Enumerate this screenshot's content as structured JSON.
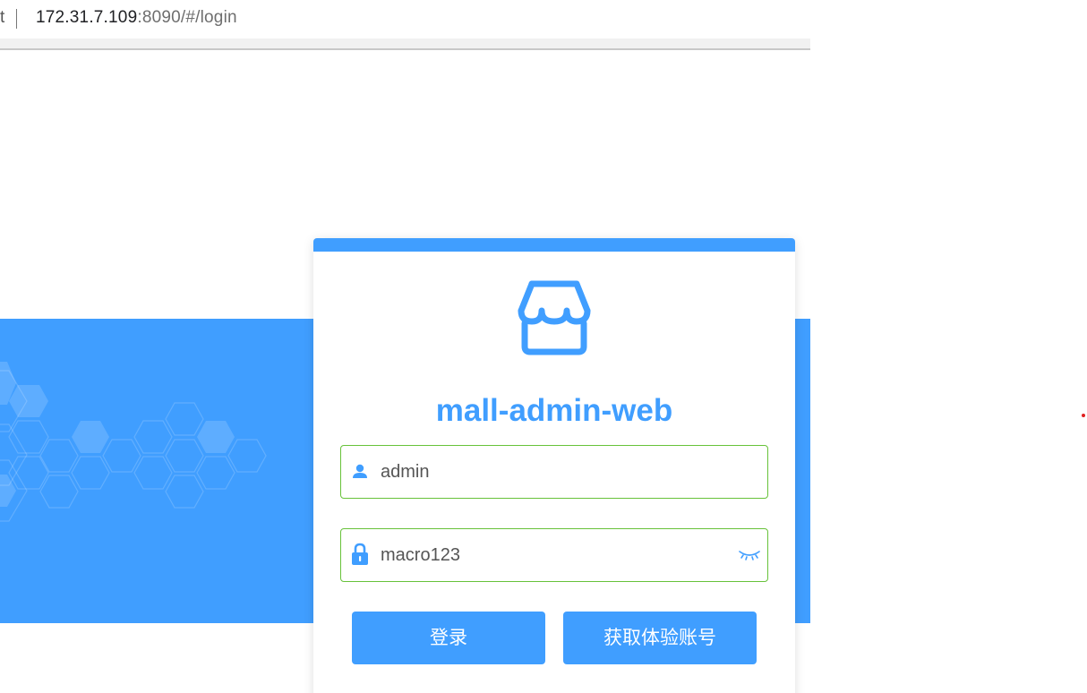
{
  "browser": {
    "url_edge_glyph": "t",
    "url_host": "172.31.7.109",
    "url_rest": ":8090/#/login"
  },
  "login": {
    "title": "mall-admin-web",
    "username": {
      "value": "admin",
      "icon": "user-icon"
    },
    "password": {
      "value": "macro123",
      "icon": "lock-icon",
      "toggle_icon": "eye-closed-icon"
    },
    "login_button": "登录",
    "trial_button": "获取体验账号"
  },
  "colors": {
    "primary": "#409eff",
    "valid_border": "#67c23a",
    "indicator": "#e02020"
  }
}
